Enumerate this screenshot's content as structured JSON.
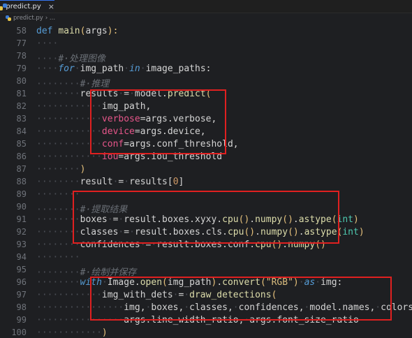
{
  "tab": {
    "filename": "predict.py",
    "close": "×"
  },
  "breadcrumb": {
    "file": "predict.py",
    "sep": "› ..."
  },
  "lines": [
    {
      "num": "58",
      "segs": [
        [
          "kw",
          "def"
        ],
        [
          "var",
          " "
        ],
        [
          "fn",
          "main"
        ],
        [
          "paren",
          "("
        ],
        [
          "var",
          "args"
        ],
        [
          "paren",
          "):"
        ]
      ]
    },
    {
      "num": "77",
      "segs": [
        [
          "ws",
          "····"
        ]
      ]
    },
    {
      "num": "78",
      "segs": [
        [
          "ws",
          "····"
        ],
        [
          "cm",
          "#·处理图像"
        ]
      ]
    },
    {
      "num": "79",
      "segs": [
        [
          "ws",
          "····"
        ],
        [
          "kwi",
          "for"
        ],
        [
          "ws",
          "·"
        ],
        [
          "var",
          "img_path"
        ],
        [
          "ws",
          "·"
        ],
        [
          "kwi",
          "in"
        ],
        [
          "ws",
          "·"
        ],
        [
          "var",
          "image_paths:"
        ]
      ]
    },
    {
      "num": "80",
      "segs": [
        [
          "ws",
          "········"
        ],
        [
          "cm",
          "#·推理"
        ]
      ]
    },
    {
      "num": "81",
      "segs": [
        [
          "ws",
          "········"
        ],
        [
          "var",
          "results"
        ],
        [
          "ws",
          "·"
        ],
        [
          "op",
          "="
        ],
        [
          "ws",
          "·"
        ],
        [
          "var",
          "model."
        ],
        [
          "fn",
          "predict"
        ],
        [
          "paren",
          "("
        ]
      ]
    },
    {
      "num": "82",
      "segs": [
        [
          "ws",
          "············"
        ],
        [
          "var",
          "img_path,"
        ]
      ]
    },
    {
      "num": "83",
      "segs": [
        [
          "ws",
          "············"
        ],
        [
          "kwarg",
          "verbose"
        ],
        [
          "op",
          "="
        ],
        [
          "var",
          "args.verbose,"
        ]
      ]
    },
    {
      "num": "84",
      "segs": [
        [
          "ws",
          "············"
        ],
        [
          "kwarg",
          "device"
        ],
        [
          "op",
          "="
        ],
        [
          "var",
          "args.device,"
        ]
      ]
    },
    {
      "num": "85",
      "segs": [
        [
          "ws",
          "············"
        ],
        [
          "kwarg",
          "conf"
        ],
        [
          "op",
          "="
        ],
        [
          "var",
          "args.conf_threshold,"
        ]
      ]
    },
    {
      "num": "86",
      "segs": [
        [
          "ws",
          "············"
        ],
        [
          "kwarg",
          "iou"
        ],
        [
          "op",
          "="
        ],
        [
          "var",
          "args.iou_threshold"
        ]
      ]
    },
    {
      "num": "87",
      "segs": [
        [
          "ws",
          "········"
        ],
        [
          "paren",
          ")"
        ]
      ]
    },
    {
      "num": "88",
      "segs": [
        [
          "ws",
          "········"
        ],
        [
          "var",
          "result"
        ],
        [
          "ws",
          "·"
        ],
        [
          "op",
          "="
        ],
        [
          "ws",
          "·"
        ],
        [
          "var",
          "results["
        ],
        [
          "num",
          "0"
        ],
        [
          "var",
          "]"
        ]
      ]
    },
    {
      "num": "89",
      "segs": [
        [
          "ws",
          "········"
        ]
      ]
    },
    {
      "num": "90",
      "segs": [
        [
          "ws",
          "········"
        ],
        [
          "cm",
          "#·提取结果"
        ]
      ]
    },
    {
      "num": "91",
      "segs": [
        [
          "ws",
          "········"
        ],
        [
          "var",
          "boxes"
        ],
        [
          "ws",
          "·"
        ],
        [
          "op",
          "="
        ],
        [
          "ws",
          "·"
        ],
        [
          "var",
          "result.boxes.xyxy."
        ],
        [
          "fn",
          "cpu"
        ],
        [
          "paren",
          "()"
        ],
        [
          "var",
          "."
        ],
        [
          "fn",
          "numpy"
        ],
        [
          "paren",
          "()"
        ],
        [
          "var",
          "."
        ],
        [
          "fn",
          "astype"
        ],
        [
          "paren",
          "("
        ],
        [
          "bt",
          "int"
        ],
        [
          "paren",
          ")"
        ]
      ]
    },
    {
      "num": "92",
      "segs": [
        [
          "ws",
          "········"
        ],
        [
          "var",
          "classes"
        ],
        [
          "ws",
          "·"
        ],
        [
          "op",
          "="
        ],
        [
          "ws",
          "·"
        ],
        [
          "var",
          "result.boxes.cls."
        ],
        [
          "fn",
          "cpu"
        ],
        [
          "paren",
          "()"
        ],
        [
          "var",
          "."
        ],
        [
          "fn",
          "numpy"
        ],
        [
          "paren",
          "()"
        ],
        [
          "var",
          "."
        ],
        [
          "fn",
          "astype"
        ],
        [
          "paren",
          "("
        ],
        [
          "bt",
          "int"
        ],
        [
          "paren",
          ")"
        ]
      ]
    },
    {
      "num": "93",
      "segs": [
        [
          "ws",
          "········"
        ],
        [
          "var",
          "confidences"
        ],
        [
          "ws",
          "·"
        ],
        [
          "op",
          "="
        ],
        [
          "ws",
          "·"
        ],
        [
          "var",
          "result.boxes.conf."
        ],
        [
          "fn",
          "cpu"
        ],
        [
          "paren",
          "()"
        ],
        [
          "var",
          "."
        ],
        [
          "fn",
          "numpy"
        ],
        [
          "paren",
          "()"
        ]
      ]
    },
    {
      "num": "94",
      "segs": [
        [
          "ws",
          "········"
        ]
      ]
    },
    {
      "num": "95",
      "segs": [
        [
          "ws",
          "········"
        ],
        [
          "cm",
          "#·绘制并保存"
        ]
      ]
    },
    {
      "num": "96",
      "segs": [
        [
          "ws",
          "········"
        ],
        [
          "kwi",
          "with"
        ],
        [
          "ws",
          "·"
        ],
        [
          "var",
          "Image."
        ],
        [
          "fn",
          "open"
        ],
        [
          "paren",
          "("
        ],
        [
          "var",
          "img_path"
        ],
        [
          "paren",
          ")"
        ],
        [
          "var",
          "."
        ],
        [
          "fn",
          "convert"
        ],
        [
          "paren",
          "("
        ],
        [
          "str",
          "\"RGB\""
        ],
        [
          "paren",
          ")"
        ],
        [
          "ws",
          "·"
        ],
        [
          "kwi",
          "as"
        ],
        [
          "ws",
          "·"
        ],
        [
          "var",
          "img:"
        ]
      ]
    },
    {
      "num": "97",
      "segs": [
        [
          "ws",
          "············"
        ],
        [
          "var",
          "img_with_dets"
        ],
        [
          "ws",
          "·"
        ],
        [
          "op",
          "="
        ],
        [
          "ws",
          "·"
        ],
        [
          "fn",
          "draw_detections"
        ],
        [
          "paren",
          "("
        ]
      ]
    },
    {
      "num": "98",
      "segs": [
        [
          "ws",
          "················"
        ],
        [
          "var",
          "img,"
        ],
        [
          "ws",
          "·"
        ],
        [
          "var",
          "boxes,"
        ],
        [
          "ws",
          "·"
        ],
        [
          "var",
          "classes,"
        ],
        [
          "ws",
          "·"
        ],
        [
          "var",
          "confidences,"
        ],
        [
          "ws",
          "·"
        ],
        [
          "var",
          "model.names,"
        ],
        [
          "ws",
          "·"
        ],
        [
          "var",
          "colors,"
        ]
      ]
    },
    {
      "num": "99",
      "segs": [
        [
          "ws",
          "················"
        ],
        [
          "var",
          "args.line_width_ratio,"
        ],
        [
          "ws",
          "·"
        ],
        [
          "var",
          "args.font_size_ratio"
        ]
      ]
    },
    {
      "num": "100",
      "segs": [
        [
          "ws",
          "············"
        ],
        [
          "paren",
          ")"
        ]
      ]
    }
  ]
}
